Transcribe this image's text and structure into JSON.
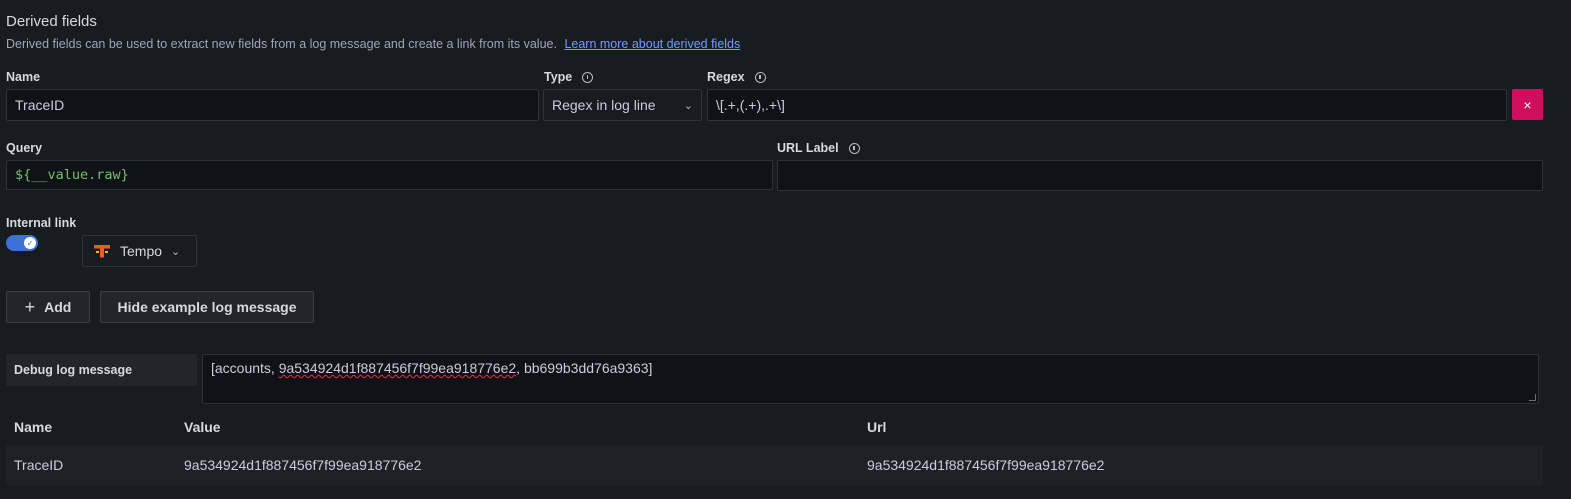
{
  "section": {
    "title": "Derived fields",
    "description": "Derived fields can be used to extract new fields from a log message and create a link from its value.",
    "learn_more": "Learn more about derived fields"
  },
  "field": {
    "name_label": "Name",
    "name_value": "TraceID",
    "type_label": "Type",
    "type_value": "Regex in log line",
    "regex_label": "Regex",
    "regex_value": "\\[.+,(.+),.+\\]",
    "remove_icon": "×",
    "query_label": "Query",
    "query_value": "${__value.raw}",
    "url_label_label": "URL Label",
    "url_label_value": "",
    "internal_link_label": "Internal link",
    "internal_link_enabled": true,
    "datasource": "Tempo"
  },
  "buttons": {
    "add": "Add",
    "add_icon": "+",
    "hide_example": "Hide example log message"
  },
  "debug": {
    "label": "Debug log message",
    "message_prefix": "[accounts, ",
    "message_trace": "9a534924d1f887456f7f99ea918776e2",
    "message_suffix": ", bb699b3dd76a9363]"
  },
  "table": {
    "headers": [
      "Name",
      "Value",
      "Url"
    ],
    "rows": [
      [
        "TraceID",
        "9a534924d1f887456f7f99ea918776e2",
        "9a534924d1f887456f7f99ea918776e2"
      ]
    ]
  },
  "colors": {
    "accent": "#3d71d9",
    "danger": "#d10e5c",
    "tempo_brand": "#f05a28"
  }
}
